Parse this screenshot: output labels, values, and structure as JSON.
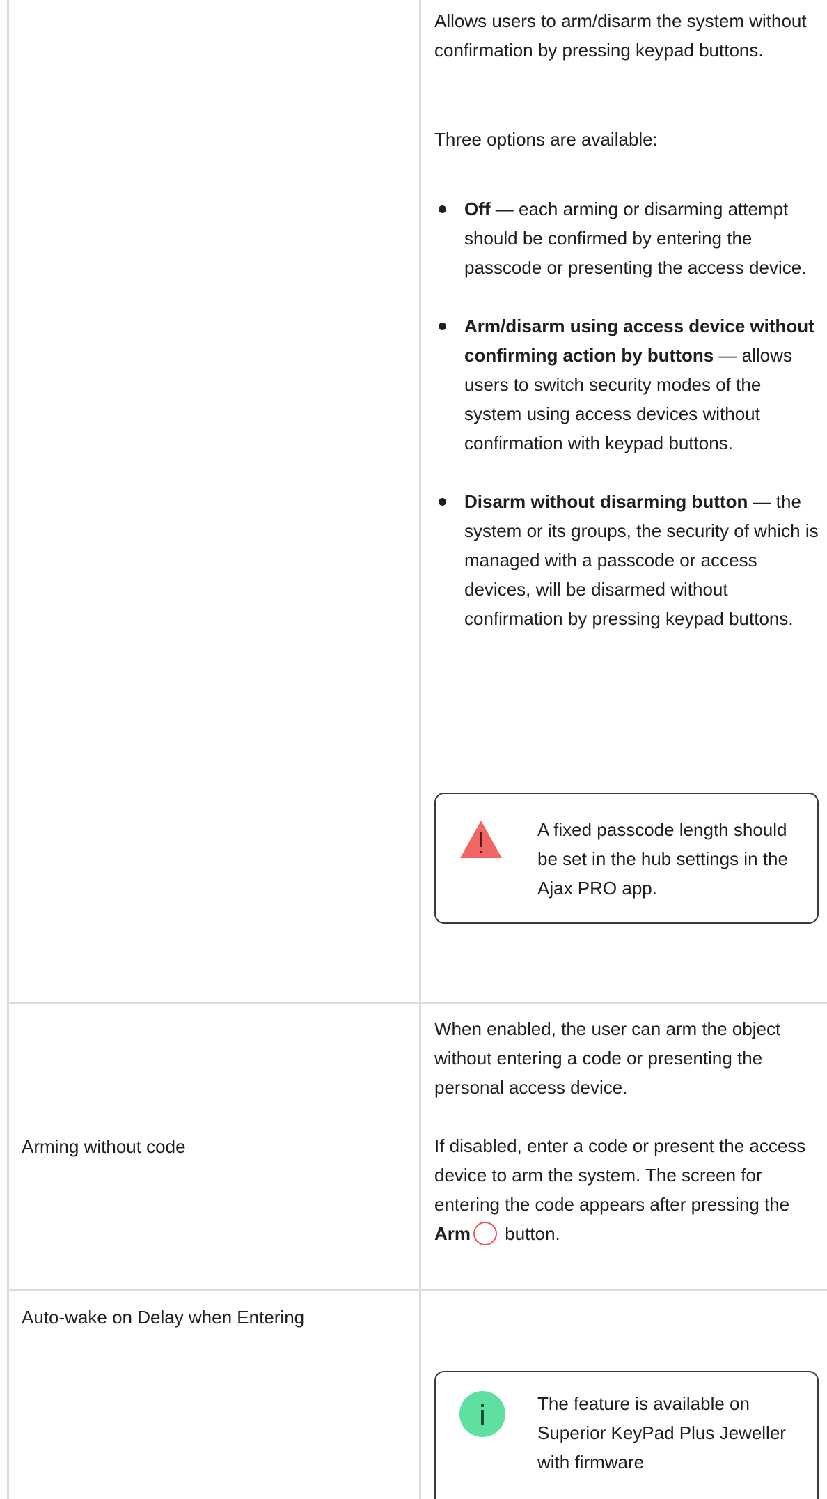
{
  "row1": {
    "paragraph1": "Allows users to arm/disarm the system without confirmation by pressing keypad buttons.",
    "paragraph2": "Three options are available:",
    "options": [
      {
        "term": "Off",
        "text": " — each arming or disarming attempt should be confirmed by entering the passcode or presenting the access device."
      },
      {
        "term": "Arm/disarm using access device without confirming action by buttons",
        "text": " — allows users to switch security modes of the system using access devices without confirmation with keypad buttons."
      },
      {
        "term": "Disarm without disarming button",
        "text": " — the system or its groups, the security of which is managed with a passcode or access devices, will be disarmed without confirmation by pressing keypad buttons."
      }
    ],
    "warning_note": "A fixed passcode length should be set in the hub settings in the Ajax PRO app."
  },
  "row2": {
    "label": "Arming without code",
    "paragraph1": "When enabled, the user can arm the object without entering a code or presenting the personal access device.",
    "paragraph2_before": "If disabled, enter a code or present the access device to arm the system. The screen for entering the code appears after pressing the ",
    "paragraph2_bold": "Arm",
    "paragraph2_after": " button."
  },
  "row3": {
    "label": "Auto-wake on Delay when Entering",
    "info_note": "The feature is available on Superior KeyPad Plus Jeweller with firmware"
  },
  "colors": {
    "warning": "#f26565",
    "info": "#5ee0a0",
    "arm_icon": "#ef5350",
    "grid": "#dcdcdc"
  },
  "icons": [
    "warning-triangle-icon",
    "info-icon",
    "arm-circle-icon"
  ]
}
